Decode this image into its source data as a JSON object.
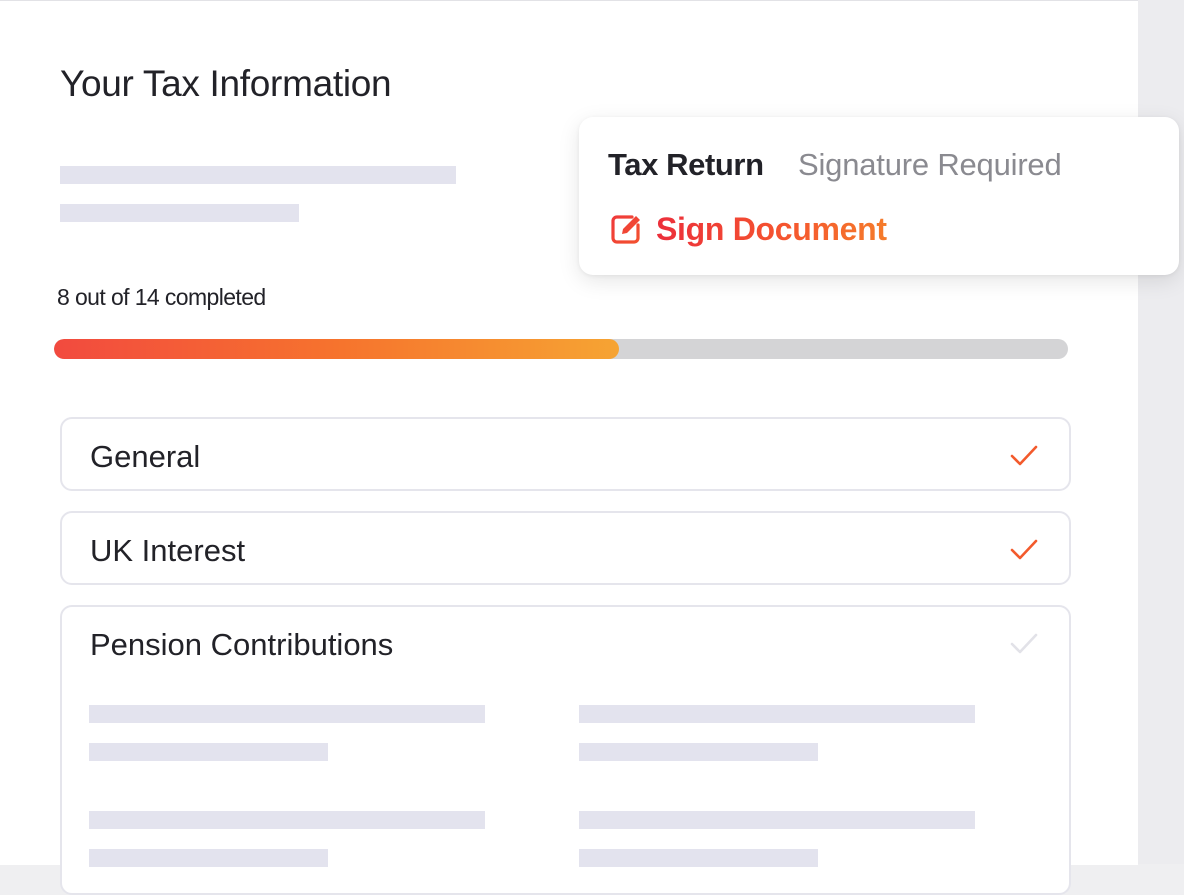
{
  "page": {
    "title": "Your Tax Information"
  },
  "progress": {
    "label": "8 out of 14 completed",
    "completed": 8,
    "total": 14,
    "fraction": 0.557
  },
  "sections": [
    {
      "label": "General",
      "status": "complete",
      "check_color": "#f35a2c"
    },
    {
      "label": "UK Interest",
      "status": "complete",
      "check_color": "#f35a2c"
    },
    {
      "label": "Pension Contributions",
      "status": "incomplete",
      "check_color": "#e2e2e8"
    }
  ],
  "popover": {
    "title": "Tax Return",
    "status": "Signature Required",
    "action_label": "Sign Document",
    "action_icon": "edit-icon"
  },
  "colors": {
    "accent_start": "#f24a3f",
    "accent_end": "#f6a433",
    "skeleton": "#e3e3ee",
    "track": "#d4d4d6"
  }
}
